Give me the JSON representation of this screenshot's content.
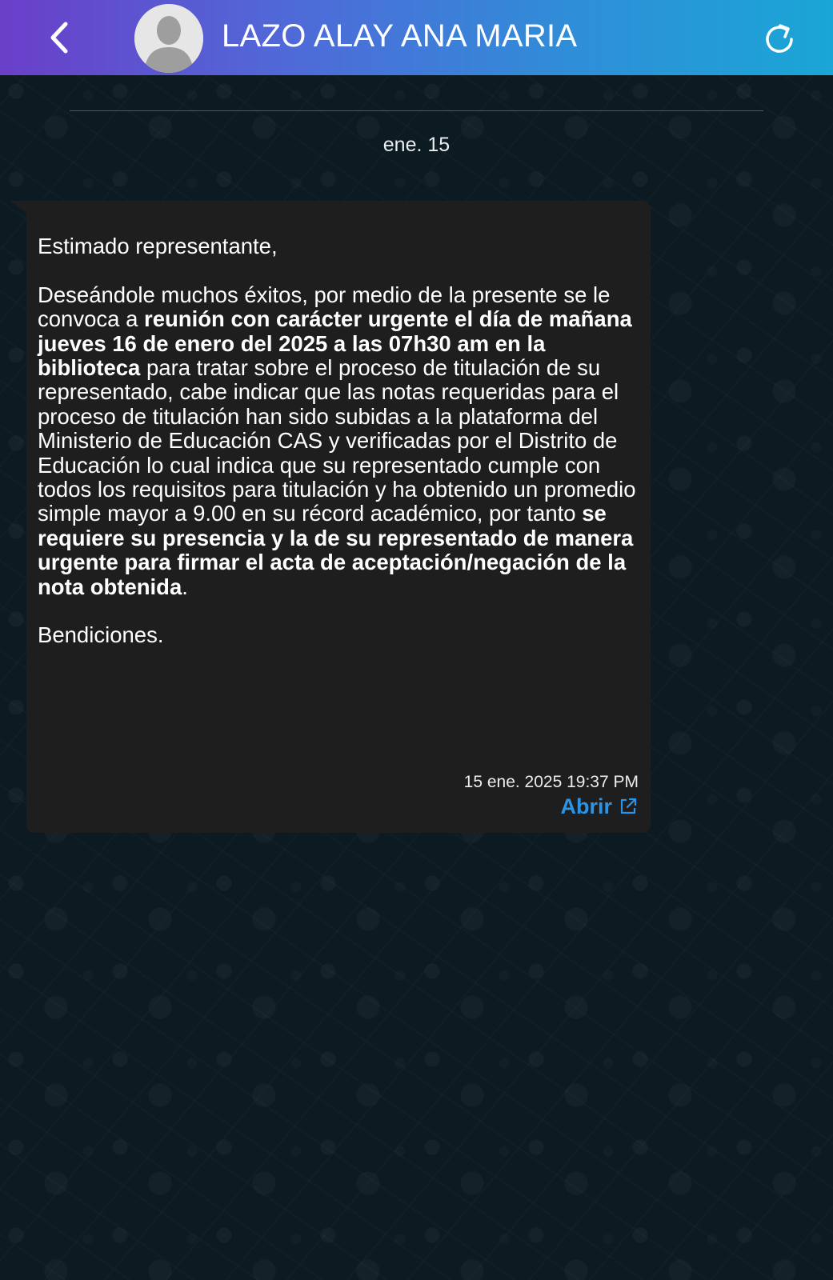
{
  "header": {
    "contact_name": "LAZO ALAY ANA MARIA",
    "back_icon": "chevron-left-icon",
    "avatar_icon": "default-avatar-icon",
    "refresh_icon": "refresh-icon",
    "gradient_colors": [
      "#6a3fc9",
      "#4f6ad8",
      "#2e8fd8",
      "#1aa6d6"
    ]
  },
  "chat": {
    "date_divider": "ene. 15",
    "message": {
      "greeting": "Estimado representante,",
      "body_1": "Deseándole muchos éxitos, por medio de la presente se le convoca a ",
      "body_bold_1": "reunión con carácter urgente el día de mañana jueves 16 de enero del 2025 a las 07h30 am en la biblioteca",
      "body_2": " para tratar sobre el proceso de titulación de su representado, cabe indicar que las notas requeridas para el proceso de titulación han sido subidas a la plataforma del Ministerio de Educación CAS y verificadas por el Distrito de Educación lo cual indica que su representado cumple con todos los requisitos para titulación y ha obtenido un promedio simple mayor a 9.00 en su récord académico, por tanto ",
      "body_bold_2": "se requiere su presencia y la de su representado de manera urgente para firmar el acta de aceptación/negación de la nota obtenida",
      "body_3": ".",
      "closing": "Bendiciones.",
      "timestamp": "15 ene. 2025 19:37 PM",
      "open_label": "Abrir",
      "open_icon": "external-link-icon"
    }
  },
  "colors": {
    "bubble_bg": "#1e1e1e",
    "chat_bg": "#0c1a22",
    "link": "#2a95e8",
    "text": "#ffffff"
  }
}
